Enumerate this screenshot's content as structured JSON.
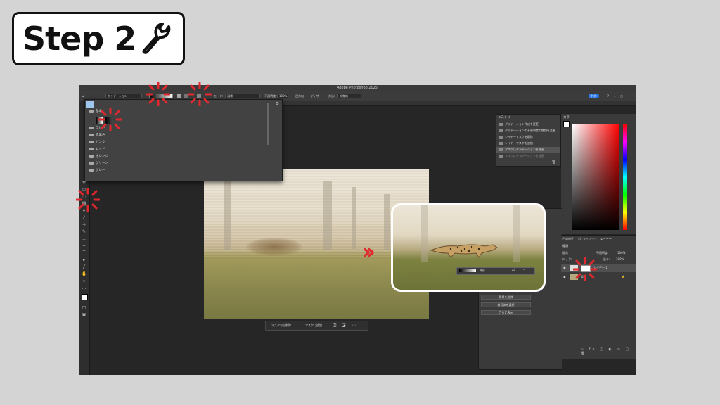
{
  "step": {
    "label": "Step 2"
  },
  "window": {
    "title": "Adobe Photoshop 2025",
    "options": {
      "preset_label": "グラデーション",
      "mode_label": "モード:",
      "mode_value": "通常",
      "opacity_label": "不透明度:",
      "opacity_value": "100%",
      "reverse_label": "逆方向",
      "dither_label": "ディザ",
      "method_label": "方法:",
      "method_value": "知覚的",
      "share_label": "共有"
    }
  },
  "gradient_presets": {
    "folders": [
      "基本",
      "ブルー",
      "赤紫色",
      "ピンク",
      "レッド",
      "オレンジ",
      "グリーン",
      "グレー"
    ]
  },
  "history": {
    "title": "ヒストリー",
    "items": [
      "グラデーション作成を変更",
      "グラデーションの不透明度の種類を変更",
      "レイヤーマスクを削除",
      "レイヤーマスクを追加",
      "マスクにグラデーションを描画",
      "マスクにグラデーションを描画"
    ]
  },
  "color_panel": {
    "title": "カラー"
  },
  "properties": {
    "buttons": [
      "背景を削除",
      "被写体を選択",
      "さらに表示"
    ]
  },
  "layers": {
    "tabs": [
      "色調補正",
      "CC ライブラリ",
      "レイヤー"
    ],
    "kind_label": "種類",
    "blend_value": "通常",
    "opacity_label": "不透明度:",
    "opacity_value": "100%",
    "lock_label": "ロック:",
    "fill_label": "塗り:",
    "fill_value": "100%",
    "items": [
      {
        "name": "レイヤー 1"
      },
      {
        "name": "背景"
      }
    ]
  },
  "contextual_bar": {
    "remove_mask_label": "マスクから削除",
    "add_mask_label": "マスクに追加"
  },
  "callout": {
    "grad_type_label": "線形"
  },
  "colors": {
    "highlight": "#e0282e",
    "accent": "#2e7ae6",
    "panel": "#3a3a3a"
  }
}
